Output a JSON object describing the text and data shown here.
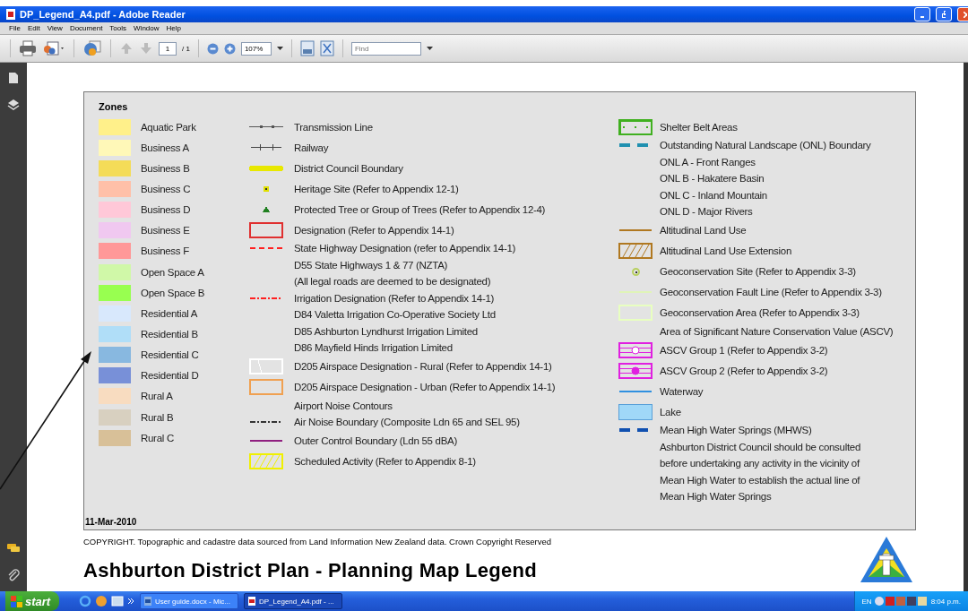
{
  "window": {
    "title": "DP_Legend_A4.pdf - Adobe Reader"
  },
  "menu": [
    "File",
    "Edit",
    "View",
    "Document",
    "Tools",
    "Window",
    "Help"
  ],
  "toolbar": {
    "page": "1",
    "page_total": "/ 1",
    "zoom": "107%",
    "find_placeholder": "Find"
  },
  "legend": {
    "zones_heading": "Zones",
    "zones": [
      {
        "label": "Aquatic Park",
        "color": "#fff08a"
      },
      {
        "label": "Business A",
        "color": "#fff8b8"
      },
      {
        "label": "Business B",
        "color": "#f4dc58"
      },
      {
        "label": "Business C",
        "color": "#ffc0a8"
      },
      {
        "label": "Business D",
        "color": "#ffc8d8"
      },
      {
        "label": "Business E",
        "color": "#f0c8f0"
      },
      {
        "label": "Business F",
        "color": "#ff9898"
      },
      {
        "label": "Open Space A",
        "color": "#d0f8a8"
      },
      {
        "label": "Open Space B",
        "color": "#98ff50"
      },
      {
        "label": "Residential A",
        "color": "#d8e8fc"
      },
      {
        "label": "Residential B",
        "color": "#b0def8"
      },
      {
        "label": "Residential C",
        "color": "#88b8e0"
      },
      {
        "label": "Residential D",
        "color": "#7890d8"
      },
      {
        "label": "Rural A",
        "color": "#f8dcc0"
      },
      {
        "label": "Rural B",
        "color": "#d8d0c0"
      },
      {
        "label": "Rural C",
        "color": "#d8c098"
      }
    ],
    "middle": [
      {
        "label": "Transmission Line",
        "kind": "transmission"
      },
      {
        "label": "Railway",
        "kind": "railway"
      },
      {
        "label": "District Council Boundary",
        "kind": "band",
        "color": "#e8e800"
      },
      {
        "label": "Heritage Site (Refer to Appendix 12-1)",
        "kind": "square-dot",
        "color": "#e0e000"
      },
      {
        "label": "Protected Tree or Group of Trees (Refer to Appendix 12-4)",
        "kind": "triangle",
        "color": "#208020"
      },
      {
        "label": "Designation (Refer to Appendix 14-1)",
        "kind": "outline",
        "color": "#e03030"
      },
      {
        "label": "State Highway Designation (refer to Appendix 14-1)",
        "kind": "dashed",
        "color": "#ff2020"
      },
      {
        "label": "D55 State Highways 1 & 77 (NZTA)",
        "kind": "text"
      },
      {
        "label": "(All legal roads are deemed to be designated)",
        "kind": "text"
      },
      {
        "label": "Irrigation Designation (Refer to Appendix 14-1)",
        "kind": "dash-dot",
        "color": "#ff2020"
      },
      {
        "label": "D84 Valetta Irrigation Co-Operative Society Ltd",
        "kind": "text"
      },
      {
        "label": "D85 Ashburton Lyndhurst Irrigation Limited",
        "kind": "text"
      },
      {
        "label": "D86 Mayfield Hinds Irrigation Limited",
        "kind": "text"
      },
      {
        "label": "D205 Airspace Designation - Rural (Refer to Appendix 14-1)",
        "kind": "slash-box",
        "color": "#ffffff"
      },
      {
        "label": "D205 Airspace Designation - Urban (Refer to Appendix 14-1)",
        "kind": "outline",
        "color": "#f0a050"
      },
      {
        "label": "Airport Noise Contours",
        "kind": "text"
      },
      {
        "label": "Air Noise Boundary (Composite Ldn 65 and SEL 95)",
        "kind": "dash-dot",
        "color": "#333333"
      },
      {
        "label": "Outer Control Boundary (Ldn 55 dBA)",
        "kind": "line",
        "color": "#902080"
      },
      {
        "label": "Scheduled Activity (Refer to Appendix 8-1)",
        "kind": "hatched",
        "color": "#f0f000"
      }
    ],
    "right": [
      {
        "label": "Shelter Belt Areas",
        "kind": "dotted-box",
        "color": "#40b020"
      },
      {
        "label": "Outstanding Natural Landscape (ONL) Boundary",
        "kind": "thick-dashed",
        "color": "#2090b0"
      },
      {
        "label": "ONL A - Front Ranges",
        "kind": "text"
      },
      {
        "label": "ONL B - Hakatere Basin",
        "kind": "text"
      },
      {
        "label": "ONL C - Inland Mountain",
        "kind": "text"
      },
      {
        "label": "ONL D - Major Rivers",
        "kind": "text"
      },
      {
        "label": "Altitudinal Land Use",
        "kind": "line",
        "color": "#b07820"
      },
      {
        "label": "Altitudinal Land Use Extension",
        "kind": "hatched",
        "color": "#b07820"
      },
      {
        "label": "Geoconservation Site (Refer to Appendix 3-3)",
        "kind": "target",
        "color": "#b8d060"
      },
      {
        "label": "Geoconservation Fault Line (Refer to Appendix 3-3)",
        "kind": "line",
        "color": "#e0f4b8"
      },
      {
        "label": "Geoconservation Area (Refer to Appendix 3-3)",
        "kind": "outline",
        "color": "#e8ffc0"
      },
      {
        "label": "Area of Significant Nature Conservation Value (ASCV)",
        "kind": "text"
      },
      {
        "label": "ASCV Group 1 (Refer to Appendix 3-2)",
        "kind": "ascv-open",
        "color": "#e020e0"
      },
      {
        "label": "ASCV Group 2 (Refer to Appendix 3-2)",
        "kind": "ascv-filled",
        "color": "#e020e0"
      },
      {
        "label": "Waterway",
        "kind": "line",
        "color": "#3090e0"
      },
      {
        "label": "Lake",
        "kind": "fill",
        "color": "#a0d8f8"
      },
      {
        "label": "Mean High Water Springs (MHWS)",
        "kind": "thick-dashed",
        "color": "#1050b0"
      },
      {
        "label": "Ashburton District Council should be consulted",
        "kind": "text"
      },
      {
        "label": "before undertaking any activity in the vicinity of",
        "kind": "text"
      },
      {
        "label": "Mean High Water to establish the actual line of",
        "kind": "text"
      },
      {
        "label": "Mean High Water Springs",
        "kind": "text"
      }
    ],
    "date": "11-Mar-2010"
  },
  "copyright": "COPYRIGHT.  Topographic and cadastre data sourced from Land Information New Zealand data. Crown Copyright Reserved",
  "heading": "Ashburton District Plan - Planning Map Legend",
  "taskbar": {
    "start": "start",
    "tasks": [
      {
        "label": "User guide.docx - Mic...",
        "selected": false
      },
      {
        "label": "DP_Legend_A4.pdf - ...",
        "selected": true
      }
    ],
    "language": "EN",
    "clock": "8:04 p.m."
  }
}
